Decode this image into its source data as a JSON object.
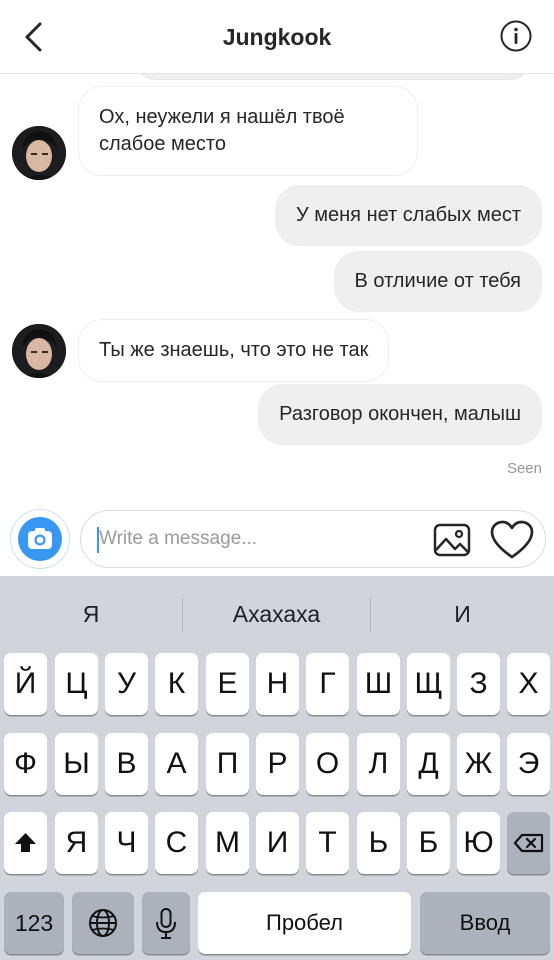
{
  "header": {
    "title": "Jungkook",
    "back_icon": "chevron-left-icon",
    "info_icon": "info-circle-icon"
  },
  "messages": [
    {
      "side": "in",
      "lines": [
        "Ох, неужели я нашёл твоё",
        "слабое место"
      ]
    },
    {
      "side": "out",
      "text": "У меня нет слабых мест"
    },
    {
      "side": "out",
      "text": "В отличие от тебя"
    },
    {
      "side": "in",
      "text": "Ты же знаешь, что это не так"
    },
    {
      "side": "out",
      "text": "Разговор окончен, малыш"
    }
  ],
  "seen_label": "Seen",
  "composer": {
    "placeholder": "Write a message...",
    "camera_icon": "camera-icon",
    "gallery_icon": "gallery-icon",
    "heart_icon": "heart-icon"
  },
  "keyboard": {
    "suggestions": [
      "Я",
      "Ахахаха",
      "И"
    ],
    "row1": [
      "Й",
      "Ц",
      "У",
      "К",
      "Е",
      "Н",
      "Г",
      "Ш",
      "Щ",
      "З",
      "Х"
    ],
    "row2": [
      "Ф",
      "Ы",
      "В",
      "А",
      "П",
      "Р",
      "О",
      "Л",
      "Д",
      "Ж",
      "Э"
    ],
    "row3": [
      "Я",
      "Ч",
      "С",
      "М",
      "И",
      "Т",
      "Ь",
      "Б",
      "Ю"
    ],
    "numbers_label": "123",
    "space_label": "Пробел",
    "enter_label": "Ввод",
    "shift_icon": "shift-icon",
    "delete_icon": "backspace-icon",
    "globe_icon": "globe-icon",
    "mic_icon": "microphone-icon"
  },
  "colors": {
    "accent": "#3897f0",
    "bubble_out": "#efefef",
    "keyboard_bg": "#d1d4da",
    "key_gray": "#acb2bb"
  }
}
